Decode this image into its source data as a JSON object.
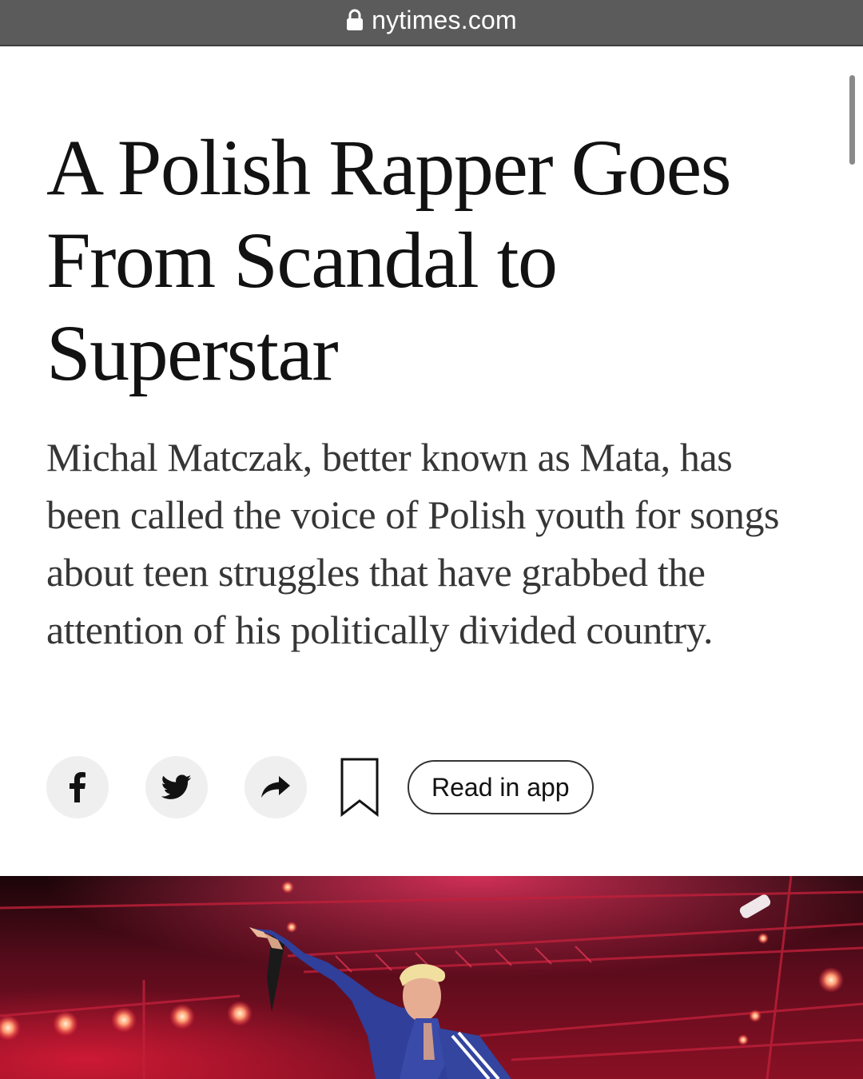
{
  "browser": {
    "url": "nytimes.com",
    "lock_icon": "lock-icon"
  },
  "article": {
    "headline": "A Polish Rapper Goes From Scandal to Superstar",
    "summary": "Michal Matczak, better known as Mata, has been called the voice of Polish youth for songs about teen struggles that have grabbed the attention of his politically divided country."
  },
  "share_bar": {
    "facebook_icon": "facebook-icon",
    "twitter_icon": "twitter-icon",
    "share_icon": "share-arrow-icon",
    "bookmark_icon": "bookmark-icon",
    "read_in_app_label": "Read in app"
  },
  "colors": {
    "url_bar": "#5b5b5b",
    "headline": "#121212",
    "summary": "#363636",
    "button_bg": "#efefef"
  }
}
